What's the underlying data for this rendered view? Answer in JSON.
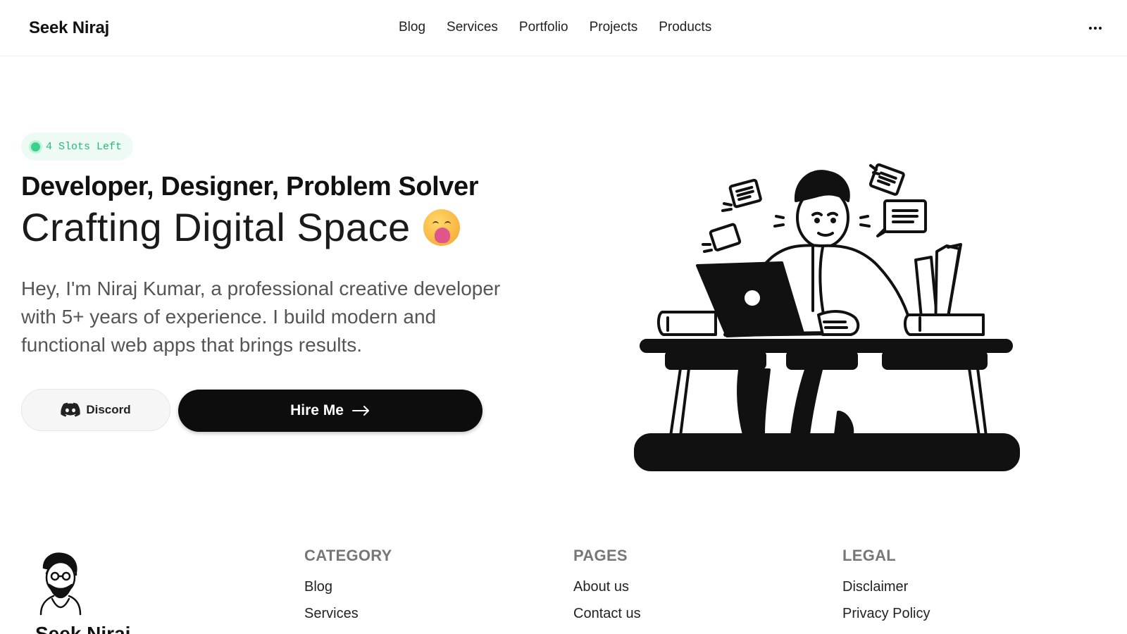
{
  "header": {
    "brand": "Seek Niraj",
    "nav": [
      "Blog",
      "Services",
      "Portfolio",
      "Projects",
      "Products"
    ],
    "more_icon": "ellipsis-icon"
  },
  "hero": {
    "badge": "4 Slots Left",
    "headline": "Developer, Designer, Problem Solver",
    "subheadline": "Crafting Digital Space",
    "subheadline_emoji": "yawning-face-icon",
    "intro": "Hey, I'm Niraj Kumar, a professional creative developer with 5+ years of experience. I build modern and functional web apps that brings results.",
    "discord_label": "Discord",
    "hire_label": "Hire Me",
    "colors": {
      "accent_green": "#25b877",
      "button_dark": "#0d0d0d"
    }
  },
  "footer": {
    "brand": "Seek Niraj",
    "columns": [
      {
        "title": "CATEGORY",
        "links": [
          "Blog",
          "Services"
        ]
      },
      {
        "title": "PAGES",
        "links": [
          "About us",
          "Contact us"
        ]
      },
      {
        "title": "LEGAL",
        "links": [
          "Disclaimer",
          "Privacy Policy"
        ]
      }
    ]
  }
}
